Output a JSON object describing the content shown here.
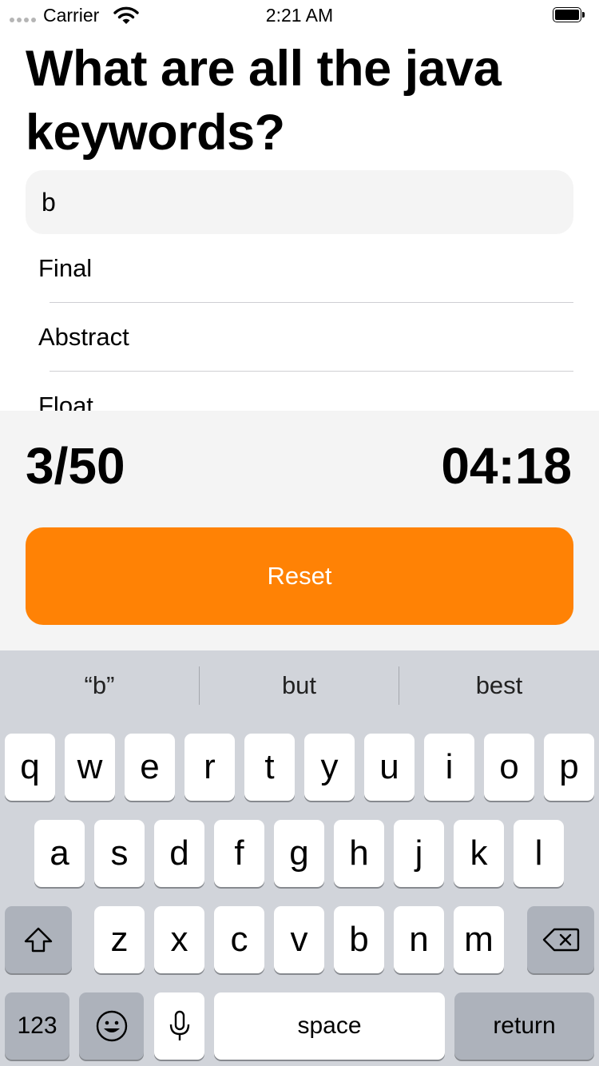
{
  "status_bar": {
    "carrier": "Carrier",
    "time": "2:21 AM"
  },
  "quiz": {
    "title": "What are all the java keywords?"
  },
  "answer_input": {
    "value": "b",
    "placeholder": ""
  },
  "answers": [
    "Final",
    "Abstract",
    "Float"
  ],
  "score": {
    "count": "3/50",
    "timer": "04:18"
  },
  "reset_label": "Reset",
  "keyboard": {
    "suggestions": [
      "“b”",
      "but",
      "best"
    ],
    "row1": [
      "q",
      "w",
      "e",
      "r",
      "t",
      "y",
      "u",
      "i",
      "o",
      "p"
    ],
    "row2": [
      "a",
      "s",
      "d",
      "f",
      "g",
      "h",
      "j",
      "k",
      "l"
    ],
    "row3": [
      "z",
      "x",
      "c",
      "v",
      "b",
      "n",
      "m"
    ],
    "numbers_label": "123",
    "space_label": "space",
    "return_label": "return"
  },
  "colors": {
    "accent": "#FF8205",
    "panel": "#F4F4F4",
    "keyboard_bg": "#D1D4DA"
  }
}
